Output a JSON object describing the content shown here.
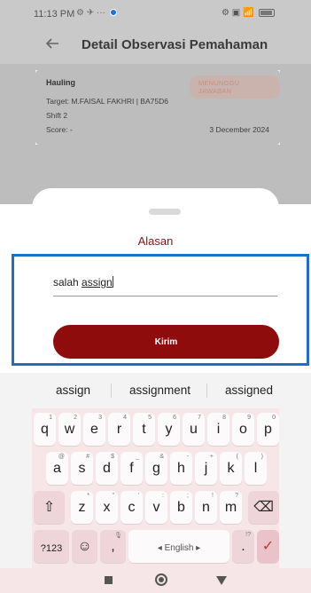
{
  "status_bar": {
    "time": "11:13 PM",
    "left_icons": "⚙ ✈ ···",
    "right_icons": "⚙ ▣ 📶"
  },
  "header": {
    "title": "Detail Observasi Pemahaman"
  },
  "card": {
    "name": "Hauling",
    "badge": "MENUNGGU JAWABAN",
    "target": "Target: M.FAISAL FAKHRI | BA75D6",
    "shift": "Shift 2",
    "score": "Score: -",
    "date": "3 December 2024"
  },
  "sheet": {
    "title": "Alasan",
    "reason_prefix": "salah ",
    "reason_underlined": "assign",
    "submit_label": "Kirim"
  },
  "keyboard": {
    "suggestions": [
      "assign",
      "assignment",
      "assigned"
    ],
    "row1": [
      {
        "key": "q",
        "hint": "1"
      },
      {
        "key": "w",
        "hint": "2"
      },
      {
        "key": "e",
        "hint": "3"
      },
      {
        "key": "r",
        "hint": "4"
      },
      {
        "key": "t",
        "hint": "5"
      },
      {
        "key": "y",
        "hint": "6"
      },
      {
        "key": "u",
        "hint": "7"
      },
      {
        "key": "i",
        "hint": "8"
      },
      {
        "key": "o",
        "hint": "9"
      },
      {
        "key": "p",
        "hint": "0"
      }
    ],
    "row2": [
      {
        "key": "a",
        "hint": "@"
      },
      {
        "key": "s",
        "hint": "#"
      },
      {
        "key": "d",
        "hint": "$"
      },
      {
        "key": "f",
        "hint": "_"
      },
      {
        "key": "g",
        "hint": "&"
      },
      {
        "key": "h",
        "hint": "-"
      },
      {
        "key": "j",
        "hint": "+"
      },
      {
        "key": "k",
        "hint": "("
      },
      {
        "key": "l",
        "hint": ")"
      }
    ],
    "row3": [
      {
        "key": "z",
        "hint": "*"
      },
      {
        "key": "x",
        "hint": "\""
      },
      {
        "key": "c",
        "hint": "'"
      },
      {
        "key": "v",
        "hint": ":"
      },
      {
        "key": "b",
        "hint": ";"
      },
      {
        "key": "n",
        "hint": "!"
      },
      {
        "key": "m",
        "hint": "?"
      }
    ],
    "shift_icon": "⇧",
    "backspace_icon": "⌫",
    "symbols_label": "?123",
    "emoji_icon": "☺",
    "comma": ",",
    "comma_hint": "🎙",
    "space_label": "◂ English ▸",
    "period": ".",
    "period_hint": "!?",
    "enter_icon": "✓"
  }
}
